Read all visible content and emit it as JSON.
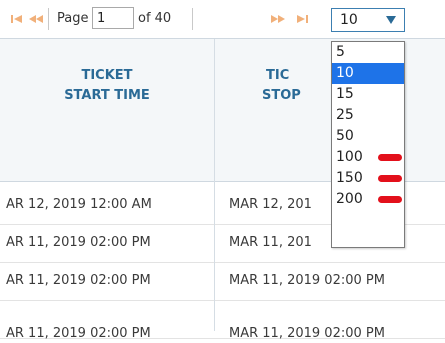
{
  "pager": {
    "icons": {
      "first": "first-page-icon",
      "prev": "prev-page-icon",
      "next": "next-page-icon",
      "last": "last-page-icon"
    },
    "page_label": "Page",
    "page_value": "1",
    "of_label": "of 40",
    "page_size_value": "10"
  },
  "page_size_options": {
    "o0": "5",
    "o1": "10",
    "o2": "15",
    "o3": "25",
    "o4": "50",
    "o5": "100",
    "o6": "150",
    "o7": "200"
  },
  "columns": {
    "start": {
      "line1": "TICKET",
      "line2": "START TIME"
    },
    "stop": {
      "line1": "TIC",
      "line2": "STOP"
    }
  },
  "rows": [
    {
      "start": "AR 12, 2019 12:00 AM",
      "stop": "MAR 12, 201"
    },
    {
      "start": "AR 11, 2019 02:00 PM",
      "stop": "MAR 11, 201"
    },
    {
      "start": "AR 11, 2019 02:00 PM",
      "stop": "MAR 11, 2019 02:00 PM"
    },
    {
      "start": "AR 11, 2019 02:00 PM",
      "stop": "MAR 11, 2019 02:00 PM"
    }
  ],
  "colors": {
    "header_text": "#2a6a96",
    "selected_bg": "#1e73e8",
    "annotation_mark": "#e3101b",
    "pager_icon": "#f1b07a"
  }
}
